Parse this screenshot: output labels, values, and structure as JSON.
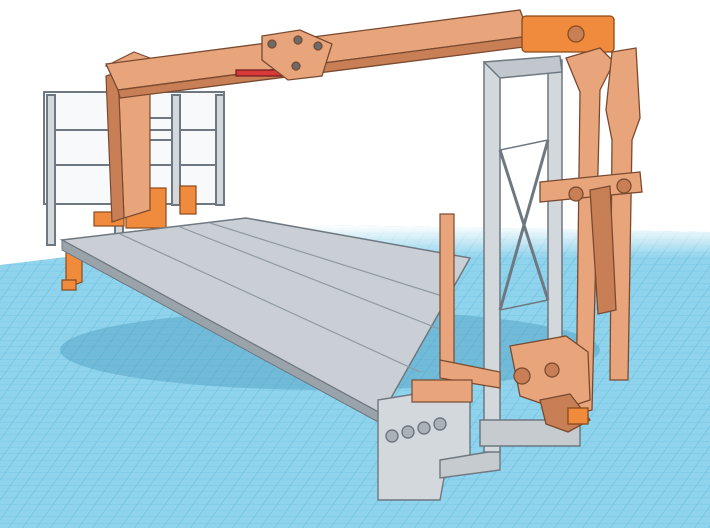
{
  "viewport": {
    "background": "#ffffff",
    "workplane_color": "#8fd3ec",
    "workplane_line_color": "#5bb8dc"
  },
  "model": {
    "colors": {
      "deck": "#c9cfd4",
      "deck_edge": "#7d8790",
      "frame": "#d3d8dc",
      "frame_edge": "#6f7880",
      "boom": "#e8a57c",
      "boom_dark": "#c97f55",
      "boom_edge": "#7a4a30",
      "orange": "#f08a3c",
      "orange_edge": "#8a4a1a",
      "accent_red": "#d83a3a"
    }
  }
}
